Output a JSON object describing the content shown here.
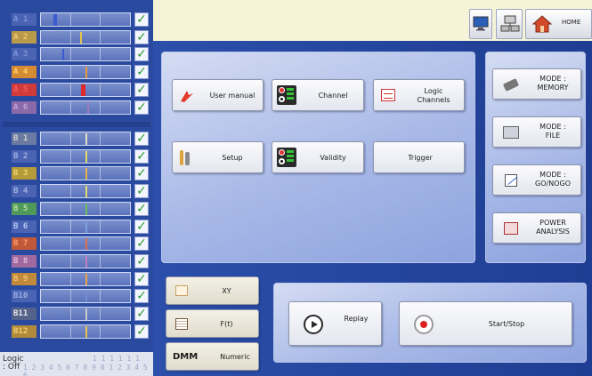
{
  "channels": {
    "group_a": [
      {
        "label": "A 1",
        "label_color": "#7f95d8",
        "label_bg": "#4a63b3",
        "mark_color": "#3b5bd1",
        "checked": true
      },
      {
        "label": "A 2",
        "label_color": "#f0c66a",
        "label_bg": "#b99a4a",
        "mark_color": "#e0c64a",
        "checked": true
      },
      {
        "label": "A 3",
        "label_color": "#7f95d8",
        "label_bg": "#4a63b3",
        "mark_color": "#3b5bd1",
        "checked": true
      },
      {
        "label": "A 4",
        "label_color": "#ffd06a",
        "label_bg": "#d58a34",
        "mark_color": "#e89a3a",
        "checked": true
      },
      {
        "label": "A 5",
        "label_color": "#ff5a5a",
        "label_bg": "#d03c3c",
        "mark_color": "#e02a2a",
        "checked": true
      },
      {
        "label": "A 6",
        "label_color": "#c8a0d8",
        "label_bg": "#8a6aa8",
        "mark_color": "#9a7ac0",
        "checked": true
      }
    ],
    "group_b": [
      {
        "label": "B 1",
        "label_color": "#d0d0d0",
        "label_bg": "#6a7aa0",
        "mark_color": "#e0e0c0",
        "checked": true
      },
      {
        "label": "B 2",
        "label_color": "#9fb0e0",
        "label_bg": "#4a63b3",
        "mark_color": "#e0d86a",
        "checked": true
      },
      {
        "label": "B 3",
        "label_color": "#f0d070",
        "label_bg": "#b59a3a",
        "mark_color": "#e6b24a",
        "checked": true
      },
      {
        "label": "B 4",
        "label_color": "#9fb0e0",
        "label_bg": "#4a63b3",
        "mark_color": "#e0d86a",
        "checked": true
      },
      {
        "label": "B 5",
        "label_color": "#b6e2a0",
        "label_bg": "#4f9a5a",
        "mark_color": "#6ac05a",
        "checked": true
      },
      {
        "label": "B 6",
        "label_color": "#b6c8f0",
        "label_bg": "#4a63b3",
        "mark_color": "#7aa0e0",
        "checked": true
      },
      {
        "label": "B 7",
        "label_color": "#ff9a6a",
        "label_bg": "#c0583a",
        "mark_color": "#e0704a",
        "checked": true
      },
      {
        "label": "B 8",
        "label_color": "#e0b8d8",
        "label_bg": "#a06aa0",
        "mark_color": "#c080c0",
        "checked": true
      },
      {
        "label": "B 9",
        "label_color": "#f0c070",
        "label_bg": "#c08a3a",
        "mark_color": "#e8a24a",
        "checked": true
      },
      {
        "label": "B10",
        "label_color": "#9fb0e0",
        "label_bg": "#4a63b3",
        "mark_color": "#7090d0",
        "checked": true
      },
      {
        "label": "B11",
        "label_color": "#e8e8e8",
        "label_bg": "#55628a",
        "mark_color": "#c8c8c8",
        "checked": true
      },
      {
        "label": "B12",
        "label_color": "#f0d070",
        "label_bg": "#b08a3a",
        "mark_color": "#e8c04a",
        "checked": true
      }
    ]
  },
  "logic": {
    "label": "Logic : Off",
    "digits_top": "1 1 1 1 1 1",
    "digits": "1 2 3 4 5 6 7 8 9 0 1 2 3 4 5 6"
  },
  "topbar": {
    "home_label": "HOME",
    "icons": [
      "monitor-icon",
      "network-icon",
      "home-icon"
    ]
  },
  "main_buttons": {
    "user_manual": "User manual",
    "channel": "Channel",
    "logic_channels": "Logic\nChannels",
    "setup": "Setup",
    "validity": "Validity",
    "trigger": "Trigger"
  },
  "mode_buttons": {
    "memory": "MODE :\nMEMORY",
    "file": "MODE :\nFILE",
    "gonogo": "MODE :\nGO/NOGO",
    "power": "POWER\nANALYSIS"
  },
  "view_buttons": {
    "xy": "XY",
    "ft": "F(t)",
    "dmm": "DMM",
    "numeric": "Numeric"
  },
  "acq_buttons": {
    "replay": "Replay",
    "start_stop": "Start/Stop"
  },
  "colors": {
    "panel_bg": "#a7b8e7",
    "background": "#1f3d92",
    "check_green": "#2f9a30"
  }
}
